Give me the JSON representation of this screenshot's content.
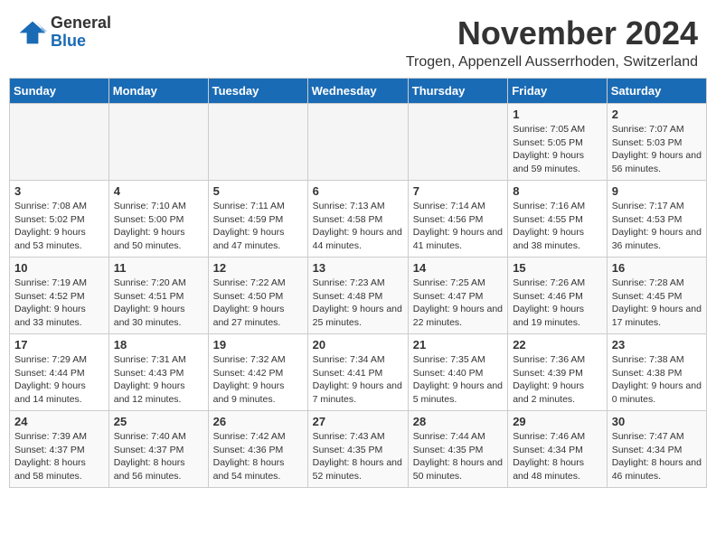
{
  "header": {
    "logo_general": "General",
    "logo_blue": "Blue",
    "month_title": "November 2024",
    "location": "Trogen, Appenzell Ausserrhoden, Switzerland"
  },
  "days_of_week": [
    "Sunday",
    "Monday",
    "Tuesday",
    "Wednesday",
    "Thursday",
    "Friday",
    "Saturday"
  ],
  "weeks": [
    [
      {
        "day": "",
        "info": ""
      },
      {
        "day": "",
        "info": ""
      },
      {
        "day": "",
        "info": ""
      },
      {
        "day": "",
        "info": ""
      },
      {
        "day": "",
        "info": ""
      },
      {
        "day": "1",
        "info": "Sunrise: 7:05 AM\nSunset: 5:05 PM\nDaylight: 9 hours and 59 minutes."
      },
      {
        "day": "2",
        "info": "Sunrise: 7:07 AM\nSunset: 5:03 PM\nDaylight: 9 hours and 56 minutes."
      }
    ],
    [
      {
        "day": "3",
        "info": "Sunrise: 7:08 AM\nSunset: 5:02 PM\nDaylight: 9 hours and 53 minutes."
      },
      {
        "day": "4",
        "info": "Sunrise: 7:10 AM\nSunset: 5:00 PM\nDaylight: 9 hours and 50 minutes."
      },
      {
        "day": "5",
        "info": "Sunrise: 7:11 AM\nSunset: 4:59 PM\nDaylight: 9 hours and 47 minutes."
      },
      {
        "day": "6",
        "info": "Sunrise: 7:13 AM\nSunset: 4:58 PM\nDaylight: 9 hours and 44 minutes."
      },
      {
        "day": "7",
        "info": "Sunrise: 7:14 AM\nSunset: 4:56 PM\nDaylight: 9 hours and 41 minutes."
      },
      {
        "day": "8",
        "info": "Sunrise: 7:16 AM\nSunset: 4:55 PM\nDaylight: 9 hours and 38 minutes."
      },
      {
        "day": "9",
        "info": "Sunrise: 7:17 AM\nSunset: 4:53 PM\nDaylight: 9 hours and 36 minutes."
      }
    ],
    [
      {
        "day": "10",
        "info": "Sunrise: 7:19 AM\nSunset: 4:52 PM\nDaylight: 9 hours and 33 minutes."
      },
      {
        "day": "11",
        "info": "Sunrise: 7:20 AM\nSunset: 4:51 PM\nDaylight: 9 hours and 30 minutes."
      },
      {
        "day": "12",
        "info": "Sunrise: 7:22 AM\nSunset: 4:50 PM\nDaylight: 9 hours and 27 minutes."
      },
      {
        "day": "13",
        "info": "Sunrise: 7:23 AM\nSunset: 4:48 PM\nDaylight: 9 hours and 25 minutes."
      },
      {
        "day": "14",
        "info": "Sunrise: 7:25 AM\nSunset: 4:47 PM\nDaylight: 9 hours and 22 minutes."
      },
      {
        "day": "15",
        "info": "Sunrise: 7:26 AM\nSunset: 4:46 PM\nDaylight: 9 hours and 19 minutes."
      },
      {
        "day": "16",
        "info": "Sunrise: 7:28 AM\nSunset: 4:45 PM\nDaylight: 9 hours and 17 minutes."
      }
    ],
    [
      {
        "day": "17",
        "info": "Sunrise: 7:29 AM\nSunset: 4:44 PM\nDaylight: 9 hours and 14 minutes."
      },
      {
        "day": "18",
        "info": "Sunrise: 7:31 AM\nSunset: 4:43 PM\nDaylight: 9 hours and 12 minutes."
      },
      {
        "day": "19",
        "info": "Sunrise: 7:32 AM\nSunset: 4:42 PM\nDaylight: 9 hours and 9 minutes."
      },
      {
        "day": "20",
        "info": "Sunrise: 7:34 AM\nSunset: 4:41 PM\nDaylight: 9 hours and 7 minutes."
      },
      {
        "day": "21",
        "info": "Sunrise: 7:35 AM\nSunset: 4:40 PM\nDaylight: 9 hours and 5 minutes."
      },
      {
        "day": "22",
        "info": "Sunrise: 7:36 AM\nSunset: 4:39 PM\nDaylight: 9 hours and 2 minutes."
      },
      {
        "day": "23",
        "info": "Sunrise: 7:38 AM\nSunset: 4:38 PM\nDaylight: 9 hours and 0 minutes."
      }
    ],
    [
      {
        "day": "24",
        "info": "Sunrise: 7:39 AM\nSunset: 4:37 PM\nDaylight: 8 hours and 58 minutes."
      },
      {
        "day": "25",
        "info": "Sunrise: 7:40 AM\nSunset: 4:37 PM\nDaylight: 8 hours and 56 minutes."
      },
      {
        "day": "26",
        "info": "Sunrise: 7:42 AM\nSunset: 4:36 PM\nDaylight: 8 hours and 54 minutes."
      },
      {
        "day": "27",
        "info": "Sunrise: 7:43 AM\nSunset: 4:35 PM\nDaylight: 8 hours and 52 minutes."
      },
      {
        "day": "28",
        "info": "Sunrise: 7:44 AM\nSunset: 4:35 PM\nDaylight: 8 hours and 50 minutes."
      },
      {
        "day": "29",
        "info": "Sunrise: 7:46 AM\nSunset: 4:34 PM\nDaylight: 8 hours and 48 minutes."
      },
      {
        "day": "30",
        "info": "Sunrise: 7:47 AM\nSunset: 4:34 PM\nDaylight: 8 hours and 46 minutes."
      }
    ]
  ]
}
